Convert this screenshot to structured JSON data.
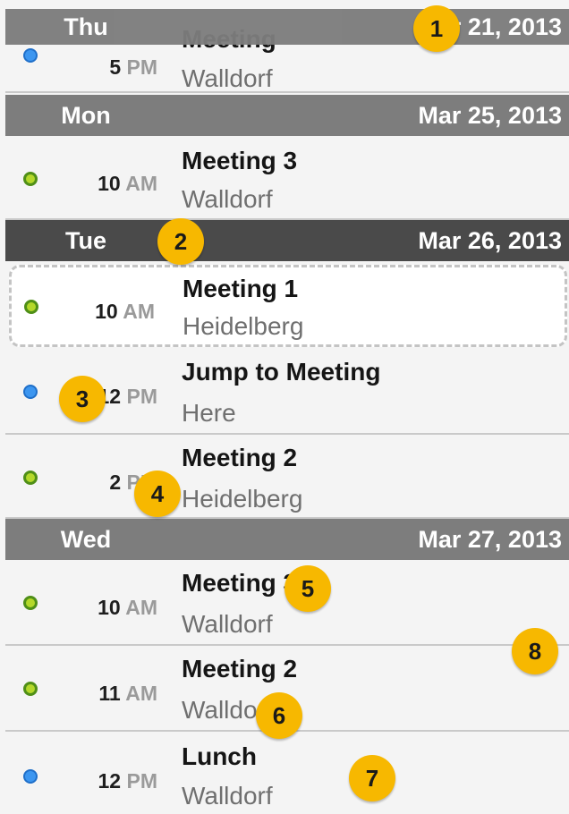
{
  "groups": [
    {
      "day": "Thu",
      "date": "Mar 21, 2013"
    },
    {
      "day": "Mon",
      "date": "Mar 25, 2013"
    },
    {
      "day": "Tue",
      "date": "Mar 26, 2013"
    },
    {
      "day": "Wed",
      "date": "Mar 27, 2013"
    }
  ],
  "events": [
    {
      "hour": "5",
      "ampm": "PM",
      "title": "Meeting",
      "location": "Walldorf",
      "color": "blue"
    },
    {
      "hour": "10",
      "ampm": "AM",
      "title": "Meeting 3",
      "location": "Walldorf",
      "color": "green"
    },
    {
      "hour": "10",
      "ampm": "AM",
      "title": "Meeting 1",
      "location": "Heidelberg",
      "color": "green"
    },
    {
      "hour": "12",
      "ampm": "PM",
      "title": "Jump to Meeting",
      "location": "Here",
      "color": "blue"
    },
    {
      "hour": "2",
      "ampm": "PM",
      "title": "Meeting 2",
      "location": "Heidelberg",
      "color": "green"
    },
    {
      "hour": "10",
      "ampm": "AM",
      "title": "Meeting 304",
      "location": "Walldorf",
      "color": "green"
    },
    {
      "hour": "11",
      "ampm": "AM",
      "title": "Meeting 2",
      "location": "Walldorf",
      "color": "green"
    },
    {
      "hour": "12",
      "ampm": "PM",
      "title": "Lunch",
      "location": "Walldorf",
      "color": "blue"
    }
  ],
  "badges": [
    "1",
    "2",
    "3",
    "4",
    "5",
    "6",
    "7",
    "8"
  ],
  "colors": {
    "header": "#7d7d7d",
    "header_selected": "#4a4a4a",
    "badge": "#f7b800",
    "dot_green": "#b4d82a",
    "dot_blue": "#3c96f0"
  }
}
